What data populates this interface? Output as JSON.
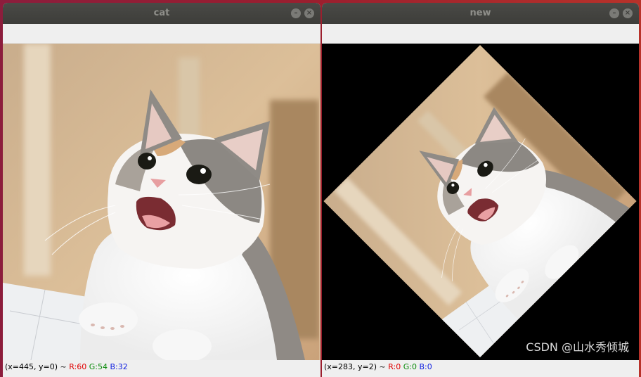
{
  "windows": [
    {
      "title": "cat",
      "status": {
        "coords": "(x=445, y=0) ~ ",
        "r": "R:60",
        "g": "G:54",
        "b": "B:32"
      }
    },
    {
      "title": "new",
      "status": {
        "coords": "(x=283, y=2) ~ ",
        "r": "R:0",
        "g": "G:0",
        "b": "B:0"
      }
    }
  ],
  "titlebar_buttons": {
    "minimize": "–",
    "close": "×"
  },
  "watermark": "CSDN @山水秀倾城",
  "colors": {
    "desktop": "#9b1f2e",
    "titlebar": "#3d3d3a",
    "rotated_background": "#000000"
  },
  "icons": [
    "minimize-icon",
    "close-icon"
  ]
}
